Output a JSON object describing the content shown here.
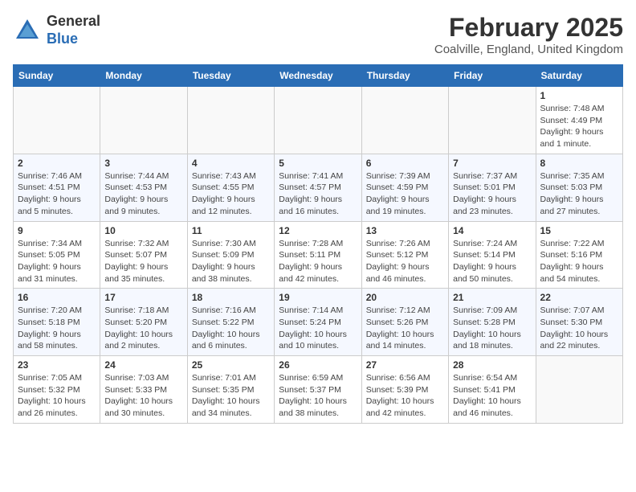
{
  "header": {
    "logo_line1": "General",
    "logo_line2": "Blue",
    "month_year": "February 2025",
    "location": "Coalville, England, United Kingdom"
  },
  "days_of_week": [
    "Sunday",
    "Monday",
    "Tuesday",
    "Wednesday",
    "Thursday",
    "Friday",
    "Saturday"
  ],
  "weeks": [
    [
      {
        "day": "",
        "info": ""
      },
      {
        "day": "",
        "info": ""
      },
      {
        "day": "",
        "info": ""
      },
      {
        "day": "",
        "info": ""
      },
      {
        "day": "",
        "info": ""
      },
      {
        "day": "",
        "info": ""
      },
      {
        "day": "1",
        "info": "Sunrise: 7:48 AM\nSunset: 4:49 PM\nDaylight: 9 hours and 1 minute."
      }
    ],
    [
      {
        "day": "2",
        "info": "Sunrise: 7:46 AM\nSunset: 4:51 PM\nDaylight: 9 hours and 5 minutes."
      },
      {
        "day": "3",
        "info": "Sunrise: 7:44 AM\nSunset: 4:53 PM\nDaylight: 9 hours and 9 minutes."
      },
      {
        "day": "4",
        "info": "Sunrise: 7:43 AM\nSunset: 4:55 PM\nDaylight: 9 hours and 12 minutes."
      },
      {
        "day": "5",
        "info": "Sunrise: 7:41 AM\nSunset: 4:57 PM\nDaylight: 9 hours and 16 minutes."
      },
      {
        "day": "6",
        "info": "Sunrise: 7:39 AM\nSunset: 4:59 PM\nDaylight: 9 hours and 19 minutes."
      },
      {
        "day": "7",
        "info": "Sunrise: 7:37 AM\nSunset: 5:01 PM\nDaylight: 9 hours and 23 minutes."
      },
      {
        "day": "8",
        "info": "Sunrise: 7:35 AM\nSunset: 5:03 PM\nDaylight: 9 hours and 27 minutes."
      }
    ],
    [
      {
        "day": "9",
        "info": "Sunrise: 7:34 AM\nSunset: 5:05 PM\nDaylight: 9 hours and 31 minutes."
      },
      {
        "day": "10",
        "info": "Sunrise: 7:32 AM\nSunset: 5:07 PM\nDaylight: 9 hours and 35 minutes."
      },
      {
        "day": "11",
        "info": "Sunrise: 7:30 AM\nSunset: 5:09 PM\nDaylight: 9 hours and 38 minutes."
      },
      {
        "day": "12",
        "info": "Sunrise: 7:28 AM\nSunset: 5:11 PM\nDaylight: 9 hours and 42 minutes."
      },
      {
        "day": "13",
        "info": "Sunrise: 7:26 AM\nSunset: 5:12 PM\nDaylight: 9 hours and 46 minutes."
      },
      {
        "day": "14",
        "info": "Sunrise: 7:24 AM\nSunset: 5:14 PM\nDaylight: 9 hours and 50 minutes."
      },
      {
        "day": "15",
        "info": "Sunrise: 7:22 AM\nSunset: 5:16 PM\nDaylight: 9 hours and 54 minutes."
      }
    ],
    [
      {
        "day": "16",
        "info": "Sunrise: 7:20 AM\nSunset: 5:18 PM\nDaylight: 9 hours and 58 minutes."
      },
      {
        "day": "17",
        "info": "Sunrise: 7:18 AM\nSunset: 5:20 PM\nDaylight: 10 hours and 2 minutes."
      },
      {
        "day": "18",
        "info": "Sunrise: 7:16 AM\nSunset: 5:22 PM\nDaylight: 10 hours and 6 minutes."
      },
      {
        "day": "19",
        "info": "Sunrise: 7:14 AM\nSunset: 5:24 PM\nDaylight: 10 hours and 10 minutes."
      },
      {
        "day": "20",
        "info": "Sunrise: 7:12 AM\nSunset: 5:26 PM\nDaylight: 10 hours and 14 minutes."
      },
      {
        "day": "21",
        "info": "Sunrise: 7:09 AM\nSunset: 5:28 PM\nDaylight: 10 hours and 18 minutes."
      },
      {
        "day": "22",
        "info": "Sunrise: 7:07 AM\nSunset: 5:30 PM\nDaylight: 10 hours and 22 minutes."
      }
    ],
    [
      {
        "day": "23",
        "info": "Sunrise: 7:05 AM\nSunset: 5:32 PM\nDaylight: 10 hours and 26 minutes."
      },
      {
        "day": "24",
        "info": "Sunrise: 7:03 AM\nSunset: 5:33 PM\nDaylight: 10 hours and 30 minutes."
      },
      {
        "day": "25",
        "info": "Sunrise: 7:01 AM\nSunset: 5:35 PM\nDaylight: 10 hours and 34 minutes."
      },
      {
        "day": "26",
        "info": "Sunrise: 6:59 AM\nSunset: 5:37 PM\nDaylight: 10 hours and 38 minutes."
      },
      {
        "day": "27",
        "info": "Sunrise: 6:56 AM\nSunset: 5:39 PM\nDaylight: 10 hours and 42 minutes."
      },
      {
        "day": "28",
        "info": "Sunrise: 6:54 AM\nSunset: 5:41 PM\nDaylight: 10 hours and 46 minutes."
      },
      {
        "day": "",
        "info": ""
      }
    ]
  ]
}
